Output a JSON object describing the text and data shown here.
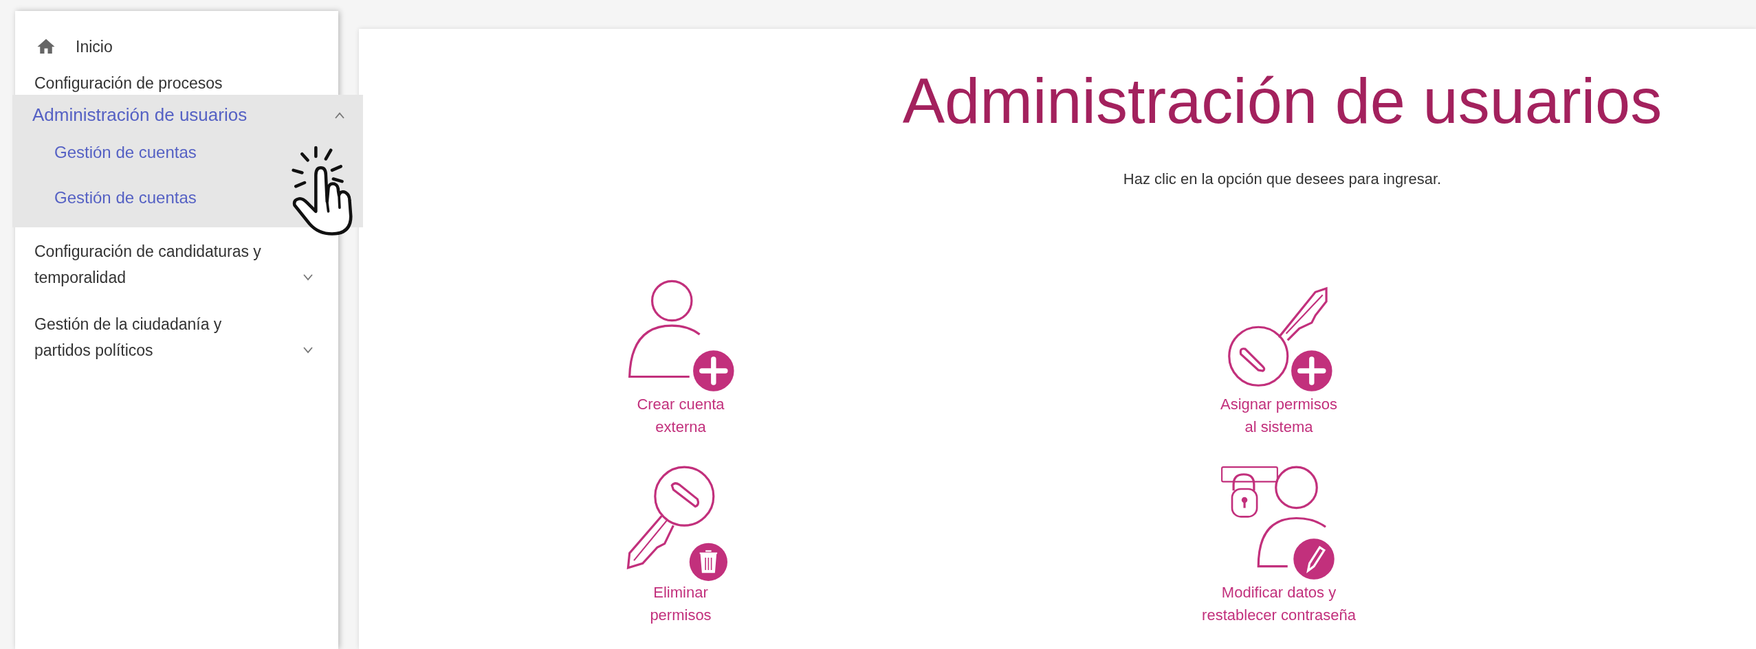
{
  "sidebar": {
    "items": [
      {
        "kind": "home",
        "label": "Inicio"
      },
      {
        "kind": "item",
        "label": "Configuración de procesos"
      },
      {
        "kind": "group",
        "label": "Administración de usuarios",
        "expanded": true,
        "children": [
          {
            "label": "Gestión de cuentas"
          },
          {
            "label": "Gestión de cuentas"
          }
        ]
      },
      {
        "kind": "group",
        "label": "Configuración de candidaturas y\ntemporalidad",
        "expanded": false
      },
      {
        "kind": "group",
        "label": "Gestión de la ciudadanía y\npartidos políticos",
        "expanded": false
      }
    ]
  },
  "page": {
    "title": "Administración de usuarios",
    "subtitle": "Haz clic en la opción que desees para ingresar."
  },
  "options": [
    {
      "kind": "add-user",
      "label": "Crear cuenta\nexterna"
    },
    {
      "kind": "add-key",
      "label": "Asignar permisos\nal sistema"
    },
    {
      "kind": "delete-key",
      "label": "Eliminar\npermisos"
    },
    {
      "kind": "edit-user",
      "label": "Modificar datos y\nrestablecer contraseña"
    }
  ]
}
